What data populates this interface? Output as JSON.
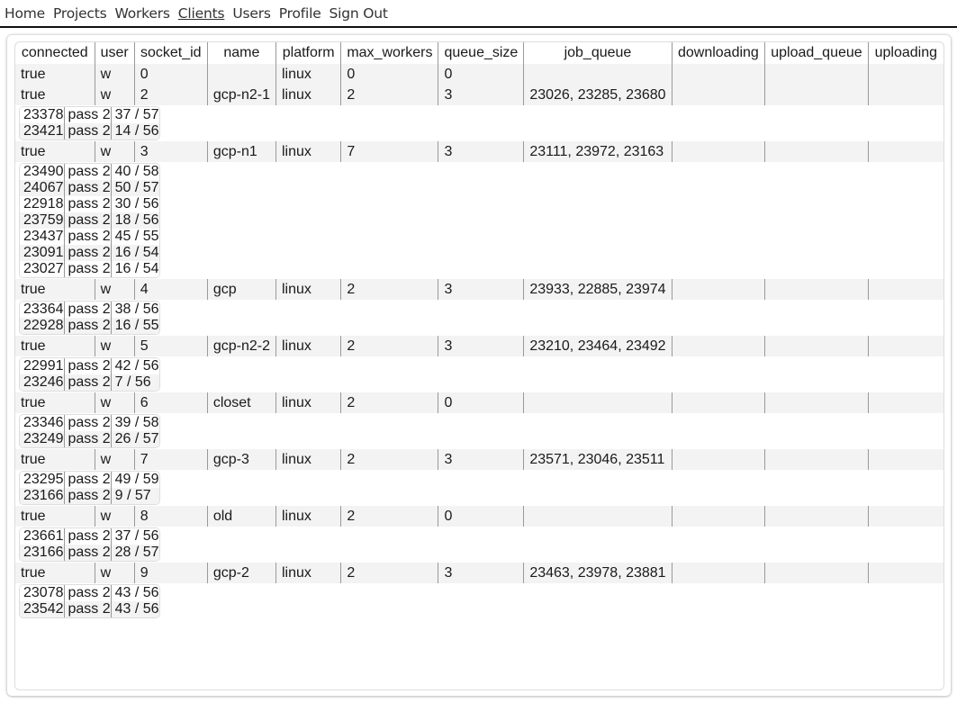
{
  "nav": {
    "items": [
      {
        "label": "Home",
        "active": false
      },
      {
        "label": "Projects",
        "active": false
      },
      {
        "label": "Workers",
        "active": false
      },
      {
        "label": "Clients",
        "active": true
      },
      {
        "label": "Users",
        "active": false
      },
      {
        "label": "Profile",
        "active": false
      },
      {
        "label": "Sign Out",
        "active": false
      }
    ]
  },
  "table": {
    "headers": [
      "connected",
      "user",
      "socket_id",
      "name",
      "platform",
      "max_workers",
      "queue_size",
      "job_queue",
      "downloading",
      "upload_queue",
      "uploading"
    ],
    "clients": [
      {
        "connected": "true",
        "user": "w",
        "socket_id": "0",
        "name": "",
        "platform": "linux",
        "max_workers": "0",
        "queue_size": "0",
        "job_queue": "",
        "downloading": "",
        "upload_queue": "",
        "uploading": "",
        "jobs": []
      },
      {
        "connected": "true",
        "user": "w",
        "socket_id": "2",
        "name": "gcp-n2-1",
        "platform": "linux",
        "max_workers": "2",
        "queue_size": "3",
        "job_queue": "23026, 23285, 23680",
        "downloading": "",
        "upload_queue": "",
        "uploading": "",
        "jobs": [
          {
            "id": "23378",
            "pass": "pass 2",
            "progress": "37 / 57"
          },
          {
            "id": "23421",
            "pass": "pass 2",
            "progress": "14 / 56"
          }
        ]
      },
      {
        "connected": "true",
        "user": "w",
        "socket_id": "3",
        "name": "gcp-n1",
        "platform": "linux",
        "max_workers": "7",
        "queue_size": "3",
        "job_queue": "23111, 23972, 23163",
        "downloading": "",
        "upload_queue": "",
        "uploading": "",
        "jobs": [
          {
            "id": "23490",
            "pass": "pass 2",
            "progress": "40 / 58"
          },
          {
            "id": "24067",
            "pass": "pass 2",
            "progress": "50 / 57"
          },
          {
            "id": "22918",
            "pass": "pass 2",
            "progress": "30 / 56"
          },
          {
            "id": "23759",
            "pass": "pass 2",
            "progress": "18 / 56"
          },
          {
            "id": "23437",
            "pass": "pass 2",
            "progress": "45 / 55"
          },
          {
            "id": "23091",
            "pass": "pass 2",
            "progress": "16 / 54"
          },
          {
            "id": "23027",
            "pass": "pass 2",
            "progress": "16 / 54"
          }
        ]
      },
      {
        "connected": "true",
        "user": "w",
        "socket_id": "4",
        "name": "gcp",
        "platform": "linux",
        "max_workers": "2",
        "queue_size": "3",
        "job_queue": "23933, 22885, 23974",
        "downloading": "",
        "upload_queue": "",
        "uploading": "",
        "jobs": [
          {
            "id": "23364",
            "pass": "pass 2",
            "progress": "38 / 56"
          },
          {
            "id": "22928",
            "pass": "pass 2",
            "progress": "16 / 55"
          }
        ]
      },
      {
        "connected": "true",
        "user": "w",
        "socket_id": "5",
        "name": "gcp-n2-2",
        "platform": "linux",
        "max_workers": "2",
        "queue_size": "3",
        "job_queue": "23210, 23464, 23492",
        "downloading": "",
        "upload_queue": "",
        "uploading": "",
        "jobs": [
          {
            "id": "22991",
            "pass": "pass 2",
            "progress": "42 / 56"
          },
          {
            "id": "23246",
            "pass": "pass 2",
            "progress": "7 / 56"
          }
        ]
      },
      {
        "connected": "true",
        "user": "w",
        "socket_id": "6",
        "name": "closet",
        "platform": "linux",
        "max_workers": "2",
        "queue_size": "0",
        "job_queue": "",
        "downloading": "",
        "upload_queue": "",
        "uploading": "",
        "jobs": [
          {
            "id": "23346",
            "pass": "pass 2",
            "progress": "39 / 58"
          },
          {
            "id": "23249",
            "pass": "pass 2",
            "progress": "26 / 57"
          }
        ]
      },
      {
        "connected": "true",
        "user": "w",
        "socket_id": "7",
        "name": "gcp-3",
        "platform": "linux",
        "max_workers": "2",
        "queue_size": "3",
        "job_queue": "23571, 23046, 23511",
        "downloading": "",
        "upload_queue": "",
        "uploading": "",
        "jobs": [
          {
            "id": "23295",
            "pass": "pass 2",
            "progress": "49 / 59"
          },
          {
            "id": "23166",
            "pass": "pass 2",
            "progress": "9 / 57"
          }
        ]
      },
      {
        "connected": "true",
        "user": "w",
        "socket_id": "8",
        "name": "old",
        "platform": "linux",
        "max_workers": "2",
        "queue_size": "0",
        "job_queue": "",
        "downloading": "",
        "upload_queue": "",
        "uploading": "",
        "jobs": [
          {
            "id": "23661",
            "pass": "pass 2",
            "progress": "37 / 56"
          },
          {
            "id": "23166",
            "pass": "pass 2",
            "progress": "28 / 57"
          }
        ]
      },
      {
        "connected": "true",
        "user": "w",
        "socket_id": "9",
        "name": "gcp-2",
        "platform": "linux",
        "max_workers": "2",
        "queue_size": "3",
        "job_queue": "23463, 23978, 23881",
        "downloading": "",
        "upload_queue": "",
        "uploading": "",
        "jobs": [
          {
            "id": "23078",
            "pass": "pass 2",
            "progress": "43 / 56"
          },
          {
            "id": "23542",
            "pass": "pass 2",
            "progress": "43 / 56"
          }
        ]
      }
    ]
  }
}
